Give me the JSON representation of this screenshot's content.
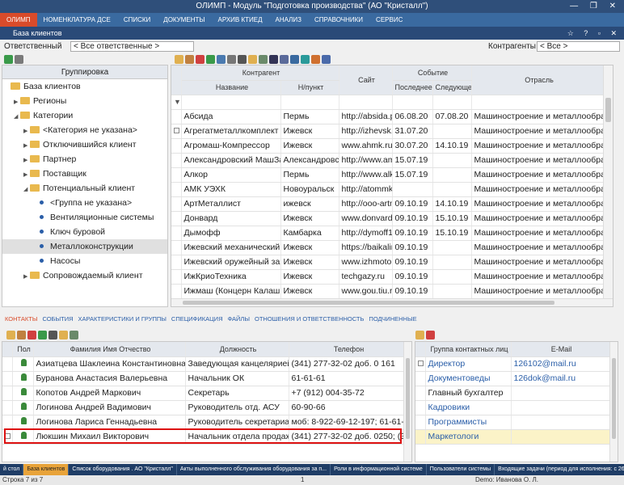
{
  "window": {
    "title": "ОЛИМП - Модуль \"Подготовка производства\" (АО \"Кристалл\")",
    "controls": "— ❐ ✕"
  },
  "menu": [
    "ОЛИМП",
    "НОМЕНКЛАТУРА ДСЕ",
    "СПИСКИ",
    "ДОКУМЕНТЫ",
    "АРХИВ КТИЕД",
    "АНАЛИЗ",
    "СПРАВОЧНИКИ",
    "СЕРВИС"
  ],
  "doc": {
    "title": "База клиентов",
    "controls": "☆ ? ▫ ✕"
  },
  "filters": {
    "resp_label": "Ответственный",
    "resp_value": "< Все ответственные >",
    "contr_label": "Контрагенты",
    "contr_value": "< Все >"
  },
  "tree": {
    "header": "Группировка",
    "items": [
      {
        "label": "База клиентов",
        "level": 0,
        "kind": "folder",
        "arrow": ""
      },
      {
        "label": "Регионы",
        "level": 1,
        "kind": "folder",
        "arrow": "▶"
      },
      {
        "label": "Категории",
        "level": 1,
        "kind": "folder",
        "arrow": "◢"
      },
      {
        "label": "<Категория не указана>",
        "level": 2,
        "kind": "folder",
        "arrow": "▶"
      },
      {
        "label": "Отключившийся клиент",
        "level": 2,
        "kind": "folder",
        "arrow": "▶"
      },
      {
        "label": "Партнер",
        "level": 2,
        "kind": "folder",
        "arrow": "▶"
      },
      {
        "label": "Поставщик",
        "level": 2,
        "kind": "folder",
        "arrow": "▶"
      },
      {
        "label": "Потенциальный клиент",
        "level": 2,
        "kind": "folder",
        "arrow": "◢"
      },
      {
        "label": "<Группа не указана>",
        "level": 3,
        "kind": "dot",
        "arrow": ""
      },
      {
        "label": "Вентиляционные системы",
        "level": 3,
        "kind": "dot",
        "arrow": ""
      },
      {
        "label": "Ключ буровой",
        "level": 3,
        "kind": "dot",
        "arrow": ""
      },
      {
        "label": "Металлоконструкции",
        "level": 3,
        "kind": "dot",
        "arrow": "",
        "selected": true
      },
      {
        "label": "Насосы",
        "level": 3,
        "kind": "dot",
        "arrow": ""
      },
      {
        "label": "Сопровождаемый клиент",
        "level": 2,
        "kind": "folder",
        "arrow": "▶"
      }
    ]
  },
  "grid": {
    "group_contr": "Контрагент",
    "group_event": "Событие",
    "col_name": "Название",
    "col_city": "Н/пункт",
    "col_site": "Сайт",
    "col_last": "Последнее",
    "col_next": "Следующее",
    "col_ind": "Отрасль",
    "rows": [
      [
        "Абсида",
        "Пермь",
        "http://absida.p",
        "06.08.20",
        "07.08.20",
        "Машиностроение и металлообработка"
      ],
      [
        "Агрегатметаллкомплект",
        "Ижевск",
        "http://izhevsk.g",
        "31.07.20",
        "",
        "Машиностроение и металлообработка"
      ],
      [
        "Агромаш-Компрессор",
        "Ижевск",
        "www.ahmk.ru",
        "30.07.20",
        "14.10.19",
        "Машиностроение и металлообработка"
      ],
      [
        "Александровский МашЗав",
        "Александровск",
        "http://www.amz",
        "15.07.19",
        "",
        "Машиностроение и металлообработка"
      ],
      [
        "Алкор",
        "Пермь",
        "http://www.alko",
        "15.07.19",
        "",
        "Машиностроение и металлообработка"
      ],
      [
        "АМК УЭХК",
        "Новоуральск",
        "http://atommk.r",
        "",
        "",
        "Машиностроение и металлообработка"
      ],
      [
        "АртМеталлист",
        "ижевск",
        "http://ooo-artm",
        "09.10.19",
        "14.10.19",
        "Машиностроение и металлообработка"
      ],
      [
        "Донвард",
        "Ижевск",
        "www.donvard.r",
        "09.10.19",
        "15.10.19",
        "Машиностроение и металлообработка"
      ],
      [
        "Дымофф",
        "Камбарка",
        "http://dymoff18",
        "09.10.19",
        "15.10.19",
        "Машиностроение и металлообработка"
      ],
      [
        "Ижевский механический за",
        "Ижевск",
        "https://baikalin",
        "09.10.19",
        "",
        "Машиностроение и металлообработка"
      ],
      [
        "Ижевский оружейный заво",
        "Ижевск",
        "www.izhmoto.r",
        "09.10.19",
        "",
        "Машиностроение и металлообработка"
      ],
      [
        "ИжКриоТехника",
        "Ижевск",
        "techgazy.ru",
        "09.10.19",
        "",
        "Машиностроение и металлообработка"
      ],
      [
        "Ижмаш (Концерн Калашник",
        "Ижевск",
        "www.gou.tiu.ru",
        "09.10.19",
        "",
        "Машиностроение и металлообработка"
      ]
    ]
  },
  "tabs": [
    "КОНТАКТЫ",
    "СОБЫТИЯ",
    "ХАРАКТЕРИСТИКИ И ГРУППЫ",
    "СПЕЦИФИКАЦИЯ",
    "ФАЙЛЫ",
    "ОТНОШЕНИЯ И ОТВЕТСТВЕННОСТЬ",
    "ПОДЧИНЕННЫЕ"
  ],
  "contacts": {
    "col_sex": "Пол",
    "col_fio": "Фамилия Имя Отчество",
    "col_pos": "Должность",
    "col_phone": "Телефон",
    "rows": [
      [
        "Азиатцева Шаклеина Константиновна",
        "Заведующая канцелярией",
        "(341) 277-32-02 доб. 0 161"
      ],
      [
        "Буранова Анастасия Валерьевна",
        "Начальник ОК",
        "61-61-61"
      ],
      [
        "Копотов Андрей Маркович",
        "Секретарь",
        "+7 (912) 004-35-72"
      ],
      [
        "Логинова Андрей Вадимович",
        "Руководитель отд. АСУ",
        "60-90-66"
      ],
      [
        "Логинова Лариса Геннадьевна",
        "Руководитель секретариата",
        "моб: 8-922-69-12-197; 61-61-61("
      ],
      [
        "Люкшин Михаил Викторович",
        "Начальник отдела продаж",
        "(341) 277-32-02 доб. 0250; (341"
      ]
    ]
  },
  "groups": {
    "col_group": "Группа контактных лиц",
    "col_email": "E-Mail",
    "rows": [
      [
        "Директор",
        "126102@mail.ru"
      ],
      [
        "Документоведы",
        "126dok@mail.ru"
      ],
      [
        "Главный бухгалтер",
        ""
      ],
      [
        "Кадровики",
        ""
      ],
      [
        "Программисты",
        ""
      ],
      [
        "Маркетологи",
        ""
      ]
    ]
  },
  "taskbar": [
    "й стол",
    "База клиентов",
    "Список оборудования . АО \"Кристалл\"",
    "Акты выполненного обслуживания оборудования за п...",
    "Роли в информационной системе",
    "Пользователи системы",
    "Входящие задачи (период для исполнения: с 26.02.20..."
  ],
  "status": {
    "left": "Строка 7 из 7",
    "mid": "1",
    "right": "Demo: Иванова О. Л."
  }
}
